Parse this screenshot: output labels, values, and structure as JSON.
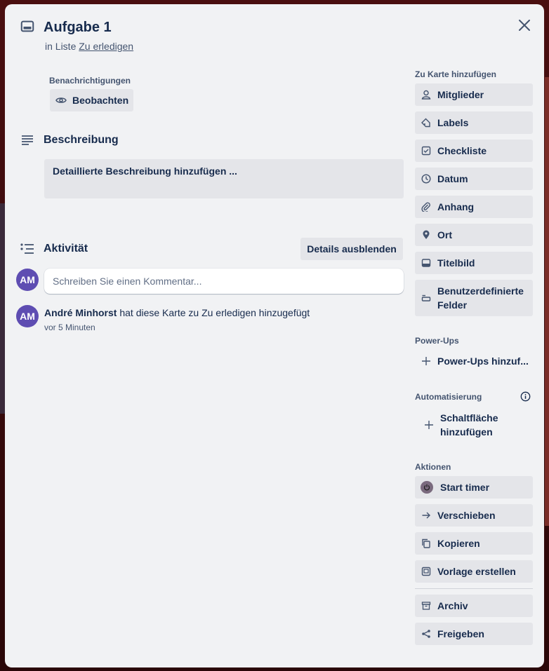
{
  "card": {
    "title": "Aufgabe 1",
    "subtitle_prefix": "in Liste",
    "list_name": "Zu erledigen"
  },
  "notifications": {
    "label": "Benachrichtigungen",
    "watch_label": "Beobachten"
  },
  "description": {
    "title": "Beschreibung",
    "placeholder": "Detaillierte Beschreibung hinzufügen ..."
  },
  "activity": {
    "title": "Aktivität",
    "details_button": "Details ausblenden",
    "comment_placeholder": "Schreiben Sie einen Kommentar...",
    "avatar_initials": "AM",
    "entries": [
      {
        "user": "André Minhorst",
        "text": "hat diese Karte zu Zu erledigen hinzugefügt",
        "time": "vor 5 Minuten"
      }
    ]
  },
  "sidebar": {
    "add_to_card_label": "Zu Karte hinzufügen",
    "add_to_card": [
      {
        "label": "Mitglieder",
        "icon": "person-icon"
      },
      {
        "label": "Labels",
        "icon": "tag-icon"
      },
      {
        "label": "Checkliste",
        "icon": "checkbox-icon"
      },
      {
        "label": "Datum",
        "icon": "clock-icon"
      },
      {
        "label": "Anhang",
        "icon": "paperclip-icon"
      },
      {
        "label": "Ort",
        "icon": "location-pin-icon"
      },
      {
        "label": "Titelbild",
        "icon": "cover-image-icon"
      },
      {
        "label": "Benutzerdefinierte Felder",
        "icon": "custom-fields-icon"
      }
    ],
    "powerups_label": "Power-Ups",
    "powerups_add": "Power-Ups hinzuf...",
    "automation_label": "Automatisierung",
    "automation_add": "Schaltfläche hinzufügen",
    "actions_label": "Aktionen",
    "actions": [
      {
        "label": "Start timer",
        "icon": "power-timer-icon"
      },
      {
        "label": "Verschieben",
        "icon": "arrow-right-icon"
      },
      {
        "label": "Kopieren",
        "icon": "copy-icon"
      },
      {
        "label": "Vorlage erstellen",
        "icon": "template-icon"
      },
      {
        "label": "Archiv",
        "icon": "archive-icon"
      },
      {
        "label": "Freigeben",
        "icon": "share-icon"
      }
    ]
  },
  "colors": {
    "modal_bg": "#f1f2f4",
    "button_bg": "#e4e5e9",
    "avatar_bg": "#5e4db2",
    "text": "#172b4d",
    "muted_text": "#44546f"
  }
}
